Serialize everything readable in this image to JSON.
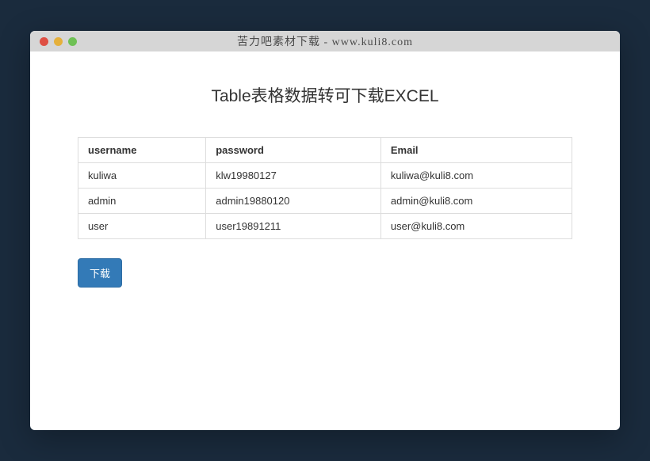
{
  "window": {
    "title": "苦力吧素材下载 - www.kuli8.com"
  },
  "page": {
    "heading": "Table表格数据转可下载EXCEL"
  },
  "table": {
    "headers": [
      "username",
      "password",
      "Email"
    ],
    "rows": [
      [
        "kuliwa",
        "klw19980127",
        "kuliwa@kuli8.com"
      ],
      [
        "admin",
        "admin19880120",
        "admin@kuli8.com"
      ],
      [
        "user",
        "user19891211",
        "user@kuli8.com"
      ]
    ]
  },
  "actions": {
    "download_label": "下载"
  }
}
